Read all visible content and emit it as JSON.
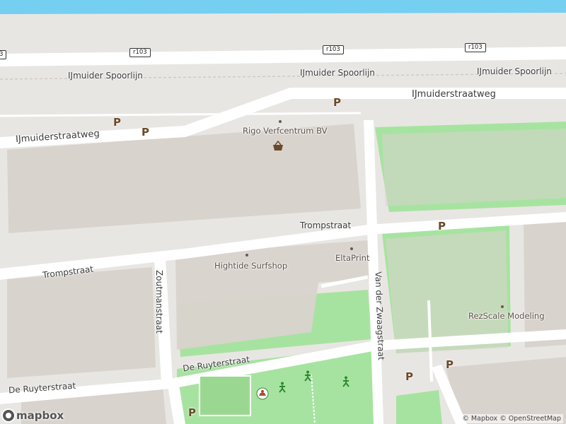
{
  "map": {
    "streets": {
      "ijmuiderstraatweg_left": "IJmuiderstraatweg",
      "ijmuiderstraatweg_right": "IJmuiderstraatweg",
      "trompstraat_left": "Trompstraat",
      "trompstraat_right": "Trompstraat",
      "zoutmanstraat": "Zoutmanstraat",
      "van_der_zwaagstraat": "Van der Zwaagstraat",
      "de_ruyterstraat_left": "De Ruyterstraat",
      "de_ruyterstraat_right": "De Ruyterstraat",
      "spoorlijn_1": "IJmuider Spoorlijn",
      "spoorlijn_2": "IJmuider Spoorlijn",
      "spoorlijn_3": "IJmuider Spoorlijn"
    },
    "road_shields": [
      "r103",
      "r103",
      "r103"
    ],
    "road_shield_cut": "3",
    "pois": {
      "rigo": "Rigo Verfcentrum BV",
      "hightide": "Hightide Surfshop",
      "eltaprint": "EltaPrint",
      "rezscale": "RezScale Modeling"
    },
    "parking_symbol": "P",
    "colors": {
      "water": "#75cff0",
      "land": "#e8e6e3",
      "road": "#ffffff",
      "park": "#a7e3a0",
      "building": "#d9d3cd",
      "parking": "#6b4a2a"
    }
  },
  "attribution": {
    "mapbox": "© Mapbox",
    "osm": "© OpenStreetMap"
  },
  "logo": {
    "text": "mapbox"
  }
}
